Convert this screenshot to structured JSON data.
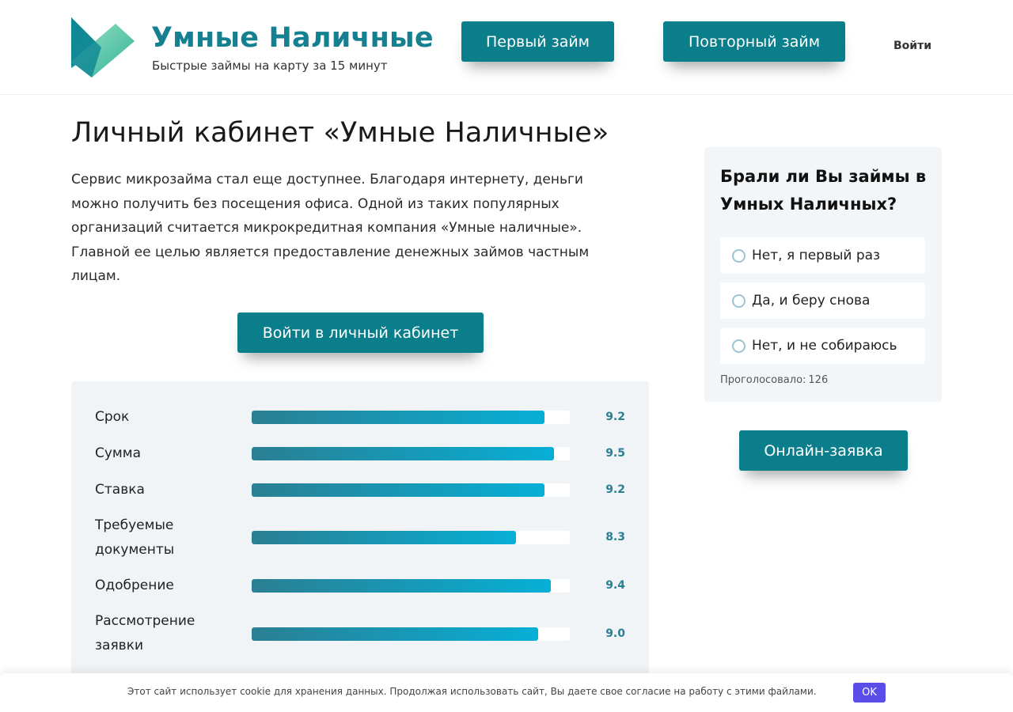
{
  "header": {
    "brand_title": "Умные Наличные",
    "brand_subtitle": "Быстрые займы на карту за 15 минут",
    "first_loan_label": "Первый займ",
    "repeat_loan_label": "Повторный займ",
    "login_label": "Войти"
  },
  "main": {
    "title": "Личный кабинет «Умные Наличные»",
    "intro": "Сервис микрозайма стал еще доступнее. Благодаря интернету, деньги можно получить без посещения офиса. Одной из таких популярных организаций считается микрокредитная компания «Умные наличные». Главной ее целью является предоставление денежных займов частным лицам.",
    "cabinet_button_label": "Войти в личный кабинет"
  },
  "ratings": {
    "max": 10,
    "items": [
      {
        "label": "Срок",
        "value": 9.2,
        "display": "9.2"
      },
      {
        "label": "Сумма",
        "value": 9.5,
        "display": "9.5"
      },
      {
        "label": "Ставка",
        "value": 9.2,
        "display": "9.2"
      },
      {
        "label": "Требуемые документы",
        "value": 8.3,
        "display": "8.3"
      },
      {
        "label": "Одобрение",
        "value": 9.4,
        "display": "9.4"
      },
      {
        "label": "Рассмотрение заявки",
        "value": 9.0,
        "display": "9.0"
      }
    ]
  },
  "poll": {
    "question": "Брали ли Вы займы в Умных Наличных?",
    "options": [
      "Нет, я первый раз",
      "Да, и беру снова",
      "Нет, и не собираюсь"
    ],
    "count_label": "Проголосовало:",
    "count_value": "126"
  },
  "sidebar": {
    "online_button_label": "Онлайн-заявка"
  },
  "cookie": {
    "text": "Этот сайт использует cookie для хранения данных. Продолжая использовать сайт, Вы даете свое согласие на работу с этими файлами.",
    "ok_label": "OK"
  },
  "colors": {
    "brand": "#15808f",
    "button": "#0b7e8c",
    "bar_start": "#2a7f93",
    "bar_end": "#07afd6",
    "cookie_ok": "#5a4de8"
  }
}
